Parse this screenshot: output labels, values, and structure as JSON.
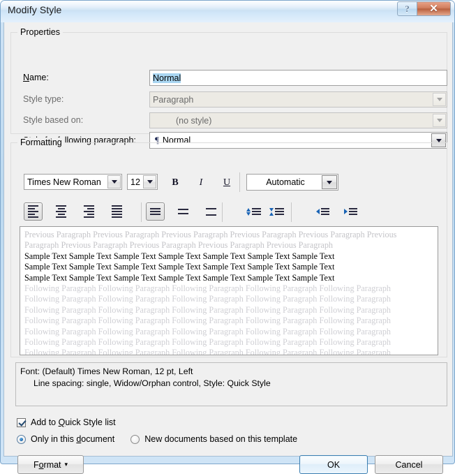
{
  "window": {
    "title": "Modify Style",
    "help_button": "?",
    "close_button": "✕"
  },
  "properties": {
    "legend": "Properties",
    "name": {
      "label": "Name:",
      "label_accel": "N",
      "value": "Normal",
      "selected": true
    },
    "style_type": {
      "label": "Style type:",
      "value": "Paragraph",
      "disabled": true
    },
    "style_based_on": {
      "label": "Style based on:",
      "value": "(no style)",
      "disabled": true
    },
    "style_following": {
      "label": "Style for following paragraph:",
      "label_accel": "S",
      "icon": "pilcrow-icon",
      "glyph": "¶",
      "value": "Normal"
    }
  },
  "formatting": {
    "legend": "Formatting",
    "font_family": "Times New Roman",
    "font_size": "12",
    "bold": "B",
    "italic": "I",
    "underline": "U",
    "font_color": "Automatic",
    "align_buttons": [
      {
        "name": "align-left",
        "selected": true
      },
      {
        "name": "align-center",
        "selected": false
      },
      {
        "name": "align-right",
        "selected": false
      },
      {
        "name": "align-justify",
        "selected": false
      }
    ],
    "line_spacing_buttons": [
      {
        "name": "line-spacing-single",
        "selected": true
      },
      {
        "name": "line-spacing-1-5",
        "selected": false
      },
      {
        "name": "line-spacing-double",
        "selected": false
      }
    ],
    "paragraph_space_buttons": [
      {
        "name": "decrease-paragraph-spacing",
        "selected": false
      },
      {
        "name": "increase-paragraph-spacing",
        "selected": false
      }
    ],
    "indent_buttons": [
      {
        "name": "decrease-indent",
        "selected": false
      },
      {
        "name": "increase-indent",
        "selected": false
      }
    ]
  },
  "preview": {
    "previous_paragraph_line1": "Previous Paragraph Previous Paragraph Previous Paragraph Previous Paragraph Previous Paragraph Previous",
    "previous_paragraph_line2": "Paragraph Previous Paragraph Previous Paragraph Previous Paragraph Previous Paragraph",
    "sample_line1": "Sample Text Sample Text Sample Text Sample Text Sample Text Sample Text Sample Text",
    "sample_line2": "Sample Text Sample Text Sample Text Sample Text Sample Text Sample Text Sample Text",
    "sample_line3": "Sample Text Sample Text Sample Text Sample Text Sample Text Sample Text Sample Text",
    "following_paragraph_line": "Following Paragraph Following Paragraph Following Paragraph Following Paragraph Following Paragraph",
    "following_paragraph_count": 8
  },
  "description": {
    "line1": "Font: (Default) Times New Roman, 12 pt, Left",
    "line2": "Line spacing:  single, Widow/Orphan control, Style: Quick Style"
  },
  "options": {
    "add_to_quick_style": {
      "label": "Add to Quick Style list",
      "checked": true
    },
    "scope_only_document": {
      "label": "Only in this document",
      "selected": true
    },
    "scope_new_documents": {
      "label": "New documents based on this template",
      "selected": false
    }
  },
  "buttons": {
    "format": "Format",
    "format_arrow": "▾",
    "ok": "OK",
    "cancel": "Cancel"
  },
  "colors": {
    "title_bar_top": "#e8f2fb",
    "close_button": "#b8603f",
    "selection_highlight": "#a9d6f2",
    "accent_focus": "#3c7fb1",
    "dialog_face": "#f0f0f0"
  }
}
